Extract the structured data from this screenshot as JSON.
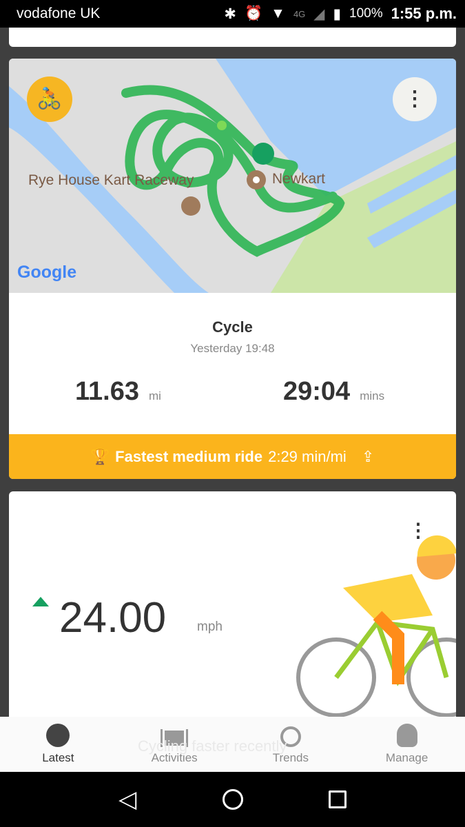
{
  "status_bar": {
    "carrier": "vodafone UK",
    "network": "4G",
    "battery": "100%",
    "time": "1:55 p.m."
  },
  "activity": {
    "map_labels": {
      "raceway": "Rye House Kart Raceway",
      "newkart": "Newkart",
      "google": "Google"
    },
    "type": "Cycle",
    "when": "Yesterday 19:48",
    "distance": "11.63",
    "distance_unit": "mi",
    "duration": "29:04",
    "duration_unit": "mins",
    "achievement_bold": "Fastest medium ride",
    "achievement_value": "2:29 min/mi",
    "colors": {
      "banner": "#fbb41c",
      "route": "#2db553"
    }
  },
  "trend": {
    "value": "24.00",
    "unit": "mph",
    "caption": "Cycling faster recently",
    "arrow_color": "#16a060"
  },
  "nav": {
    "items": [
      {
        "label": "Latest"
      },
      {
        "label": "Activities"
      },
      {
        "label": "Trends"
      },
      {
        "label": "Manage"
      }
    ]
  }
}
